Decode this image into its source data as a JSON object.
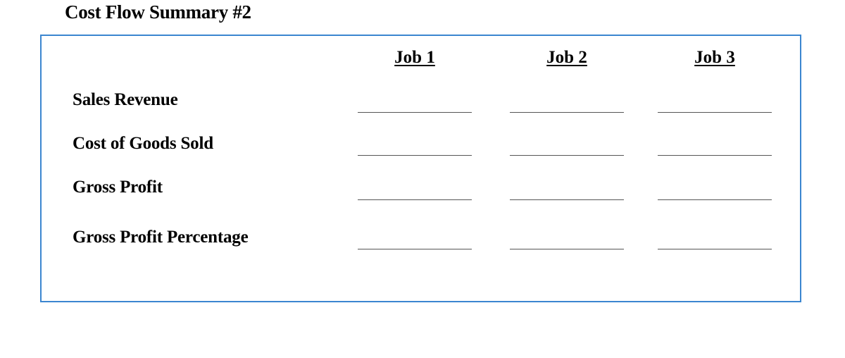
{
  "title": "Cost Flow Summary #2",
  "columns": [
    "Job 1",
    "Job 2",
    "Job 3"
  ],
  "rows": [
    {
      "label": "Sales Revenue",
      "values": [
        "",
        "",
        ""
      ]
    },
    {
      "label": "Cost of Goods Sold",
      "values": [
        "",
        "",
        ""
      ]
    },
    {
      "label": "Gross Profit",
      "values": [
        "",
        "",
        ""
      ]
    },
    {
      "label": "Gross Profit Percentage",
      "values": [
        "",
        "",
        ""
      ]
    }
  ],
  "colors": {
    "border": "#3b86d0"
  }
}
